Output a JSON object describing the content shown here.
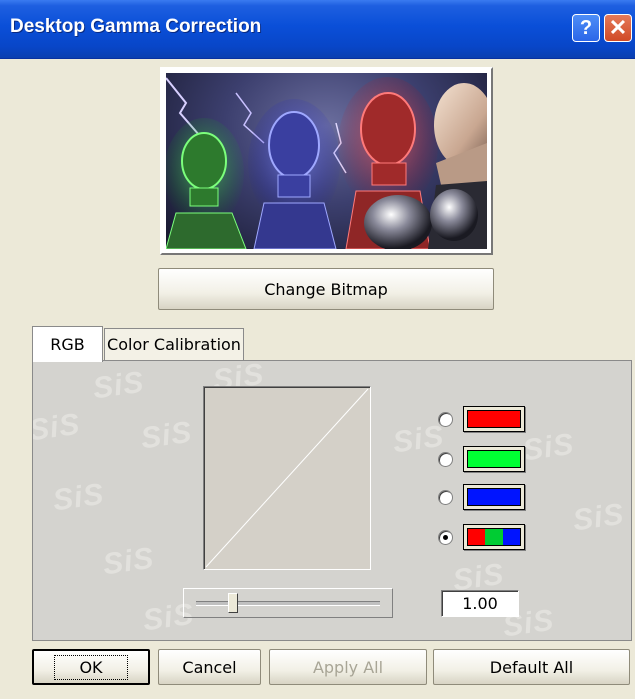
{
  "window": {
    "title": "Desktop Gamma Correction",
    "help_glyph": "?",
    "close_glyph": "✕"
  },
  "preview": {
    "change_bitmap_label": "Change Bitmap"
  },
  "tabs": [
    {
      "label": "RGB",
      "active": true
    },
    {
      "label": "Color Calibration",
      "active": false
    }
  ],
  "rgb_panel": {
    "watermark_text": "SiS",
    "channels": [
      {
        "name": "red",
        "color": "#FF0000",
        "checked": false
      },
      {
        "name": "green",
        "color": "#00FF33",
        "checked": false
      },
      {
        "name": "blue",
        "color": "#0014FF",
        "checked": false
      },
      {
        "name": "all",
        "colors": [
          "#FF0000",
          "#00CC33",
          "#0014FF"
        ],
        "checked": true
      }
    ],
    "gamma_value": "1.00",
    "slider_position": 0.2
  },
  "buttons": {
    "ok": "OK",
    "cancel": "Cancel",
    "apply_all": "Apply All",
    "default_all": "Default All"
  }
}
